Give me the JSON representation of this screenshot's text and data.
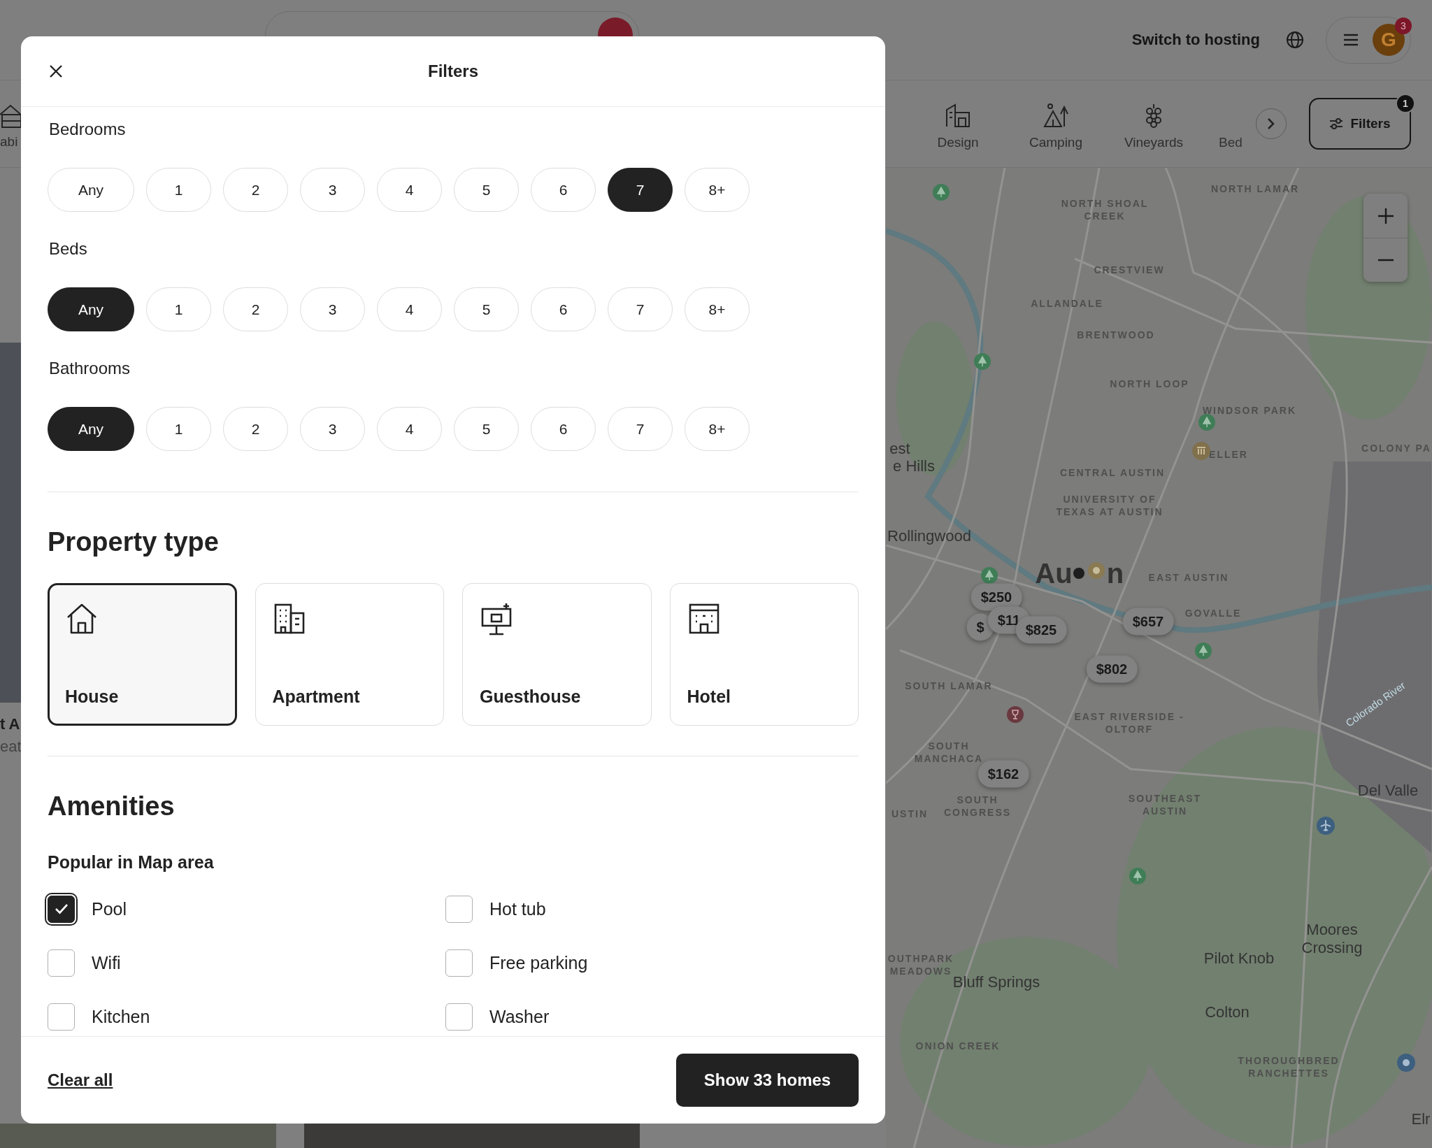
{
  "header": {
    "host_link": "Switch to hosting",
    "notification_count": "3",
    "avatar_letter": "G"
  },
  "categories": [
    {
      "label": "abi"
    },
    {
      "label": "Design"
    },
    {
      "label": "Camping"
    },
    {
      "label": "Vineyards"
    },
    {
      "label": "Bed"
    }
  ],
  "filters_button": {
    "label": "Filters",
    "badge": "1"
  },
  "listing_fragments": [
    "t A",
    "eat"
  ],
  "map": {
    "labels": [
      {
        "text": "NORTH LAMAR",
        "kind": "district"
      },
      {
        "text": "NORTH SHOAL CREEK",
        "kind": "district"
      },
      {
        "text": "CRESTVIEW",
        "kind": "district"
      },
      {
        "text": "ALLANDALE",
        "kind": "district"
      },
      {
        "text": "BRENTWOOD",
        "kind": "district"
      },
      {
        "text": "NORTH LOOP",
        "kind": "district"
      },
      {
        "text": "WINDSOR PARK",
        "kind": "district"
      },
      {
        "text": "ELLER",
        "kind": "district"
      },
      {
        "text": "COLONY PA",
        "kind": "district"
      },
      {
        "text": "CENTRAL AUSTIN",
        "kind": "district"
      },
      {
        "text": "UNIVERSITY OF TEXAS AT AUSTIN",
        "kind": "district"
      },
      {
        "text": "est",
        "kind": "place"
      },
      {
        "text": "e Hills",
        "kind": "place"
      },
      {
        "text": "Rollingwood",
        "kind": "place"
      },
      {
        "text": "Au",
        "kind": "city"
      },
      {
        "text": "n",
        "kind": "city"
      },
      {
        "text": "EAST AUSTIN",
        "kind": "district"
      },
      {
        "text": "GOVALLE",
        "kind": "district"
      },
      {
        "text": "SOUTH LAMAR",
        "kind": "district"
      },
      {
        "text": "EAST RIVERSIDE - OLTORF",
        "kind": "district"
      },
      {
        "text": "SOUTH MANCHACA",
        "kind": "district"
      },
      {
        "text": "USTIN",
        "kind": "district"
      },
      {
        "text": "SOUTH CONGRESS",
        "kind": "district"
      },
      {
        "text": "SOUTHEAST AUSTIN",
        "kind": "district"
      },
      {
        "text": "Del Valle",
        "kind": "place"
      },
      {
        "text": "OUTHPARK MEADOWS",
        "kind": "district"
      },
      {
        "text": "Bluff Springs",
        "kind": "place"
      },
      {
        "text": "Pilot Knob",
        "kind": "place"
      },
      {
        "text": "Moores Crossing",
        "kind": "place"
      },
      {
        "text": "Colton",
        "kind": "place"
      },
      {
        "text": "ONION CREEK",
        "kind": "district"
      },
      {
        "text": "THOROUGHBRED RANCHETTES",
        "kind": "district"
      },
      {
        "text": "Elr",
        "kind": "place"
      },
      {
        "text": "Colorado River",
        "kind": "water"
      }
    ],
    "prices": [
      "$250",
      "$",
      "$11",
      "$825",
      "$657",
      "$802",
      "$162"
    ]
  },
  "modal": {
    "title": "Filters",
    "counts": [
      {
        "title": "Bedrooms",
        "options": [
          {
            "label": "Any",
            "selected": false
          },
          {
            "label": "1",
            "selected": false
          },
          {
            "label": "2",
            "selected": false
          },
          {
            "label": "3",
            "selected": false
          },
          {
            "label": "4",
            "selected": false
          },
          {
            "label": "5",
            "selected": false
          },
          {
            "label": "6",
            "selected": false
          },
          {
            "label": "7",
            "selected": true
          },
          {
            "label": "8+",
            "selected": false
          }
        ]
      },
      {
        "title": "Beds",
        "options": [
          {
            "label": "Any",
            "selected": true
          },
          {
            "label": "1",
            "selected": false
          },
          {
            "label": "2",
            "selected": false
          },
          {
            "label": "3",
            "selected": false
          },
          {
            "label": "4",
            "selected": false
          },
          {
            "label": "5",
            "selected": false
          },
          {
            "label": "6",
            "selected": false
          },
          {
            "label": "7",
            "selected": false
          },
          {
            "label": "8+",
            "selected": false
          }
        ]
      },
      {
        "title": "Bathrooms",
        "options": [
          {
            "label": "Any",
            "selected": true
          },
          {
            "label": "1",
            "selected": false
          },
          {
            "label": "2",
            "selected": false
          },
          {
            "label": "3",
            "selected": false
          },
          {
            "label": "4",
            "selected": false
          },
          {
            "label": "5",
            "selected": false
          },
          {
            "label": "6",
            "selected": false
          },
          {
            "label": "7",
            "selected": false
          },
          {
            "label": "8+",
            "selected": false
          }
        ]
      }
    ],
    "property_type": {
      "title": "Property type",
      "types": [
        {
          "label": "House",
          "selected": true
        },
        {
          "label": "Apartment",
          "selected": false
        },
        {
          "label": "Guesthouse",
          "selected": false
        },
        {
          "label": "Hotel",
          "selected": false
        }
      ]
    },
    "amenities": {
      "title": "Amenities",
      "subtitle": "Popular in Map area",
      "items": [
        {
          "label": "Pool",
          "checked": true
        },
        {
          "label": "Hot tub",
          "checked": false
        },
        {
          "label": "Wifi",
          "checked": false
        },
        {
          "label": "Free parking",
          "checked": false
        },
        {
          "label": "Kitchen",
          "checked": false
        },
        {
          "label": "Washer",
          "checked": false
        }
      ]
    },
    "clear": "Clear all",
    "show": "Show 33 homes"
  }
}
